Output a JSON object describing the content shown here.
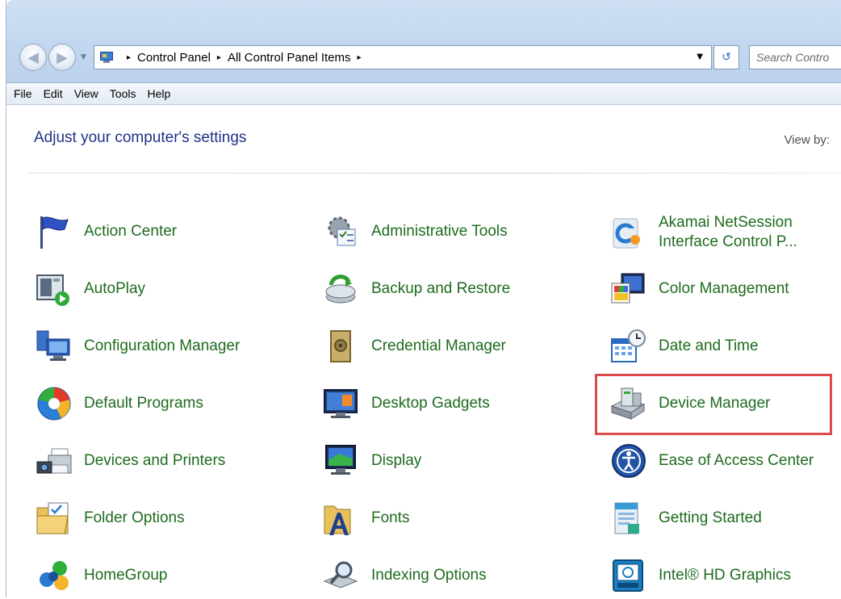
{
  "address_bar": {
    "crumbs": [
      "Control Panel",
      "All Control Panel Items"
    ],
    "separator": "▸"
  },
  "search": {
    "placeholder": "Search Contro"
  },
  "menu": [
    "File",
    "Edit",
    "View",
    "Tools",
    "Help"
  ],
  "page": {
    "heading": "Adjust your computer's settings",
    "view_by_label": "View by:"
  },
  "items": [
    {
      "label": "Action Center",
      "icon": "flag-icon"
    },
    {
      "label": "Administrative Tools",
      "icon": "admin-tools-icon"
    },
    {
      "label": "Akamai NetSession Interface Control P...",
      "icon": "akamai-icon"
    },
    {
      "label": "AutoPlay",
      "icon": "autoplay-icon"
    },
    {
      "label": "Backup and Restore",
      "icon": "backup-icon"
    },
    {
      "label": "Color Management",
      "icon": "color-management-icon"
    },
    {
      "label": "Configuration Manager",
      "icon": "configuration-icon"
    },
    {
      "label": "Credential Manager",
      "icon": "vault-icon"
    },
    {
      "label": "Date and Time",
      "icon": "calendar-clock-icon"
    },
    {
      "label": "Default Programs",
      "icon": "default-programs-icon"
    },
    {
      "label": "Desktop Gadgets",
      "icon": "gadgets-icon"
    },
    {
      "label": "Device Manager",
      "icon": "device-manager-icon"
    },
    {
      "label": "Devices and Printers",
      "icon": "printer-camera-icon"
    },
    {
      "label": "Display",
      "icon": "monitor-icon"
    },
    {
      "label": "Ease of Access Center",
      "icon": "ease-of-access-icon"
    },
    {
      "label": "Folder Options",
      "icon": "folder-options-icon"
    },
    {
      "label": "Fonts",
      "icon": "fonts-icon"
    },
    {
      "label": "Getting Started",
      "icon": "getting-started-icon"
    },
    {
      "label": "HomeGroup",
      "icon": "homegroup-icon"
    },
    {
      "label": "Indexing Options",
      "icon": "indexing-icon"
    },
    {
      "label": "Intel® HD Graphics",
      "icon": "intel-graphics-icon"
    }
  ],
  "highlighted_item": "Device Manager",
  "colors": {
    "link_green": "#1e6b1e",
    "heading_blue": "#1e3287",
    "highlight_red": "#db4b4b",
    "chrome_blue": "#c4d8f0"
  }
}
